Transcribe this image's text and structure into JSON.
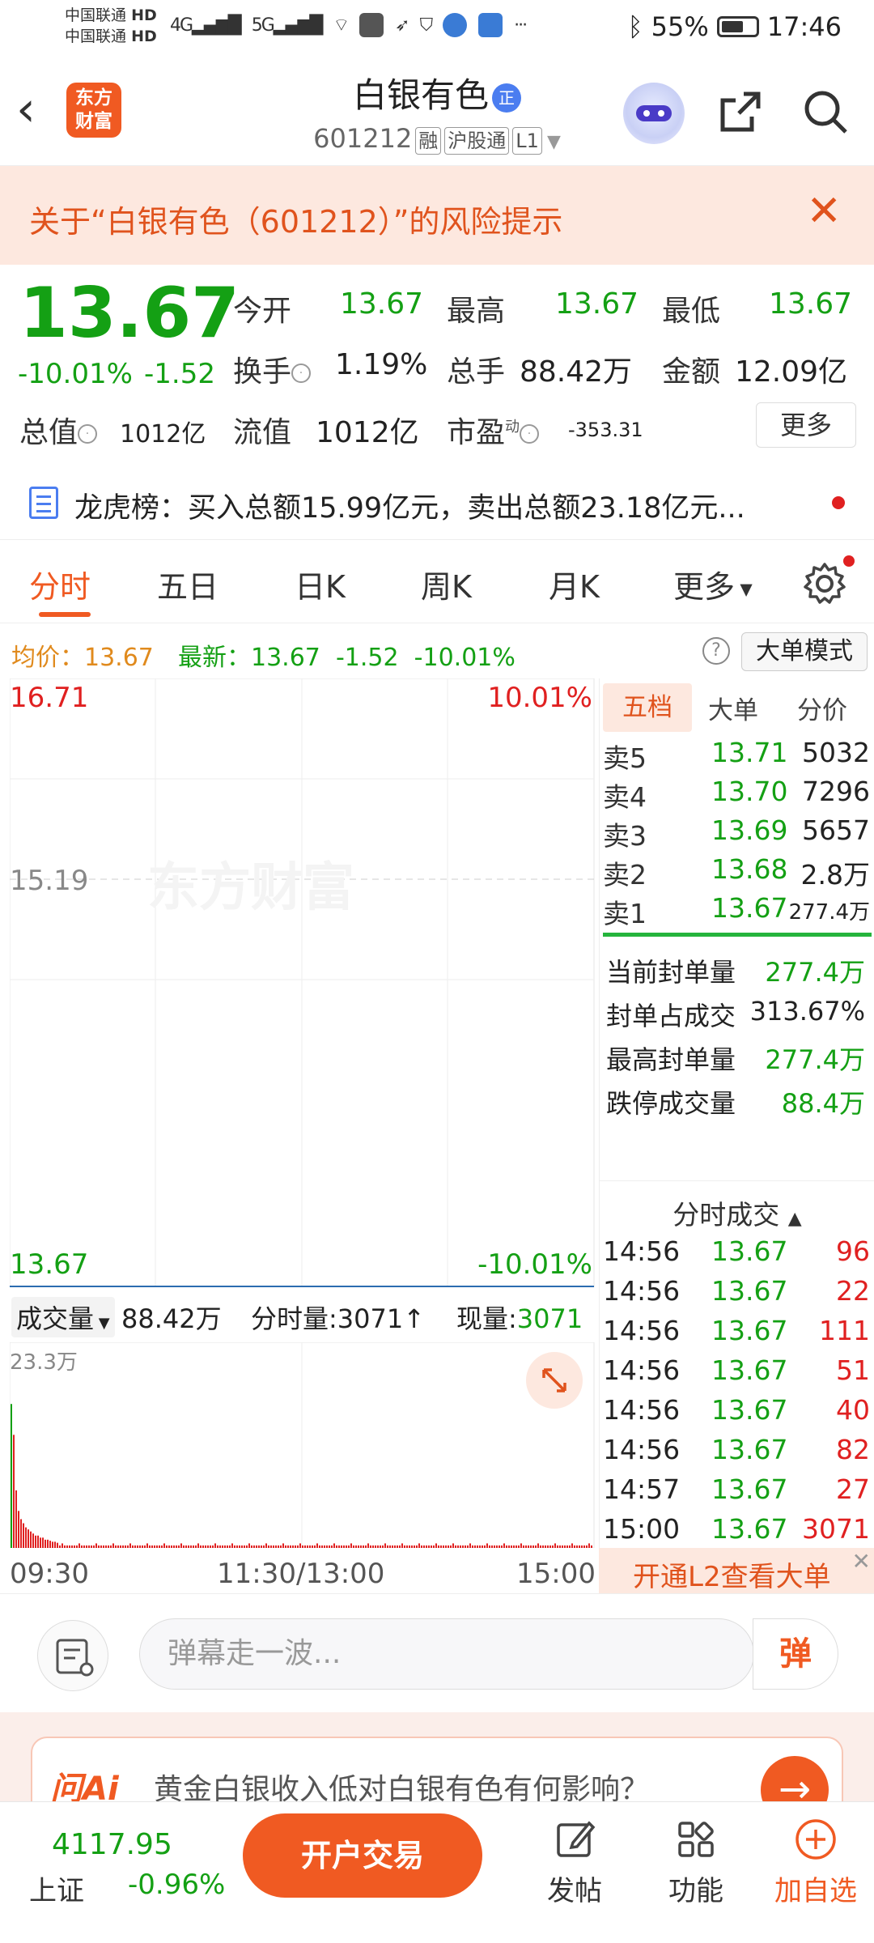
{
  "status_bar": {
    "carrier1": "中国联通",
    "carrier2": "中国联通",
    "hd": "HD",
    "net1": "4G",
    "net2": "5G",
    "battery": "55%",
    "time": "17:46",
    "more": "···"
  },
  "header": {
    "logo_line1": "东方",
    "logo_line2": "财富",
    "title": "白银有色",
    "title_badge": "正",
    "code": "601212",
    "tags": [
      "融",
      "沪股通",
      "L1"
    ]
  },
  "risk_banner": {
    "text": "关于“白银有色（601212）”的风险提示"
  },
  "quote": {
    "price": "13.67",
    "change_pct": "-10.01%",
    "change": "-1.52",
    "fields": [
      {
        "label": "今开",
        "value": "13.67"
      },
      {
        "label": "最高",
        "value": "13.67"
      },
      {
        "label": "最低",
        "value": "13.67"
      },
      {
        "label": "换手",
        "value": "1.19%"
      },
      {
        "label": "总手",
        "value": "88.42万"
      },
      {
        "label": "金额",
        "value": "12.09亿"
      },
      {
        "label": "总值",
        "value": "1012亿"
      },
      {
        "label": "流值",
        "value": "1012亿"
      },
      {
        "label": "市盈",
        "value": "-353.31",
        "superscript": "动"
      }
    ],
    "more_label": "更多"
  },
  "dragon_tiger": {
    "text": "龙虎榜：买入总额15.99亿元，卖出总额23.18亿元..."
  },
  "tabs": [
    {
      "label": "分时",
      "active": true
    },
    {
      "label": "五日",
      "active": false
    },
    {
      "label": "日K",
      "active": false
    },
    {
      "label": "周K",
      "active": false
    },
    {
      "label": "月K",
      "active": false
    },
    {
      "label": "更多",
      "active": false
    }
  ],
  "info_line": {
    "avg_label": "均价：",
    "avg_value": "13.67",
    "latest_label": "最新：",
    "latest_value": "13.67",
    "latest_change": "-1.52",
    "latest_pct": "-10.01%",
    "help": "?",
    "mode_button": "大单模式"
  },
  "chart": {
    "top_price": "16.71",
    "top_pct": "10.01%",
    "mid_price": "15.19",
    "bottom_price": "13.67",
    "bottom_pct": "-10.01%",
    "watermark": "东方财富",
    "volume_label": "成交量",
    "volume_total": "88.42万",
    "minute_volume_label": "分时量:",
    "minute_volume_value": "3071",
    "current_volume_label": "现量:",
    "current_volume_value": "3071",
    "volume_max": "23.3万",
    "time_start": "09:30",
    "time_mid": "11:30/13:00",
    "time_end": "15:00",
    "colors": {
      "price_line": "#2b6cb0",
      "volume_bars": "#e02020",
      "first_bar": "#14a014"
    }
  },
  "order_book": {
    "tabs": [
      "五档",
      "大单",
      "分价"
    ],
    "sells": [
      {
        "label": "卖5",
        "price": "13.71",
        "volume": "5032"
      },
      {
        "label": "卖4",
        "price": "13.70",
        "volume": "7296"
      },
      {
        "label": "卖3",
        "price": "13.69",
        "volume": "5657"
      },
      {
        "label": "卖2",
        "price": "13.68",
        "volume": "2.8万"
      },
      {
        "label": "卖1",
        "price": "13.67",
        "volume": "277.4万"
      }
    ],
    "seal": [
      {
        "label": "当前封单量",
        "value": "277.4万"
      },
      {
        "label": "封单占成交",
        "value": "313.67%"
      },
      {
        "label": "最高封单量",
        "value": "277.4万"
      },
      {
        "label": "跌停成交量",
        "value": "88.4万"
      }
    ],
    "ticks_title": "分时成交",
    "ticks": [
      {
        "time": "14:56",
        "price": "13.67",
        "volume": "96"
      },
      {
        "time": "14:56",
        "price": "13.67",
        "volume": "22"
      },
      {
        "time": "14:56",
        "price": "13.67",
        "volume": "111"
      },
      {
        "time": "14:56",
        "price": "13.67",
        "volume": "51"
      },
      {
        "time": "14:56",
        "price": "13.67",
        "volume": "40"
      },
      {
        "time": "14:56",
        "price": "13.67",
        "volume": "82"
      },
      {
        "time": "14:57",
        "price": "13.67",
        "volume": "27"
      },
      {
        "time": "15:00",
        "price": "13.67",
        "volume": "3071"
      }
    ],
    "l2_promo": "开通L2查看大单",
    "l2_close": "✕"
  },
  "danmaku": {
    "placeholder": "弹幕走一波...",
    "button": "弹"
  },
  "ask_ai": {
    "logo": "问Ai",
    "question": "黄金白银收入低对白银有色有何影响？",
    "go": "→"
  },
  "bottom_bar": {
    "index_value": "4117.95",
    "index_name": "上证",
    "index_change": "-0.96%",
    "open_account": "开户交易",
    "post": "发帖",
    "functions": "功能",
    "add_watch": "加自选"
  }
}
